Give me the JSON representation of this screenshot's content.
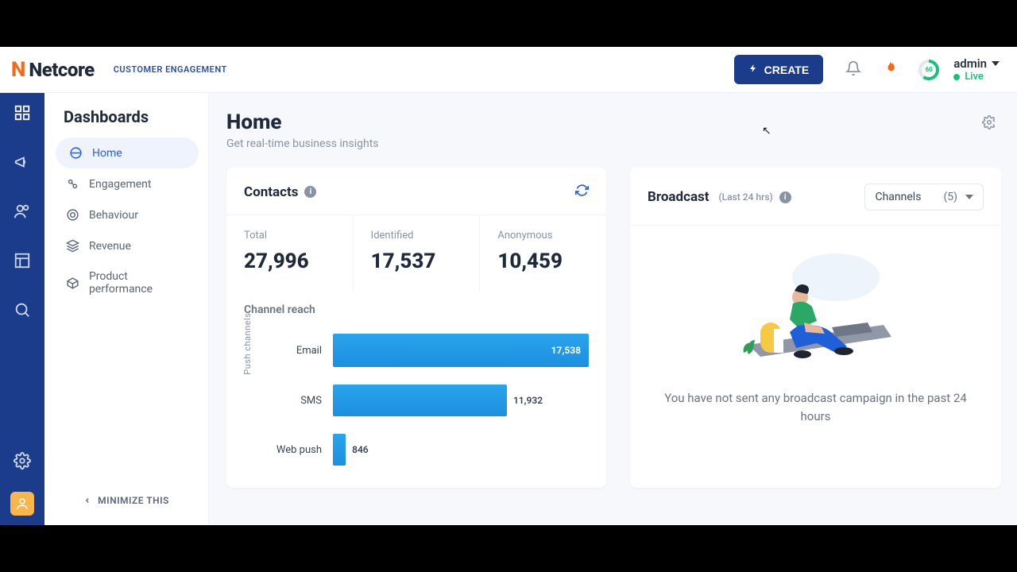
{
  "brand": {
    "mark": "N",
    "name": "Netcore",
    "sub": "CUSTOMER ENGAGEMENT"
  },
  "header": {
    "create_label": "CREATE",
    "score": "60",
    "user": "admin",
    "status": "Live"
  },
  "sidebar": {
    "title": "Dashboards",
    "items": [
      {
        "label": "Home",
        "active": true
      },
      {
        "label": "Engagement",
        "active": false
      },
      {
        "label": "Behaviour",
        "active": false
      },
      {
        "label": "Revenue",
        "active": false
      },
      {
        "label": "Product performance",
        "active": false
      }
    ],
    "minimize": "MINIMIZE THIS"
  },
  "page": {
    "title": "Home",
    "subtitle": "Get real-time business insights"
  },
  "contacts": {
    "title": "Contacts",
    "total_label": "Total",
    "total_value": "27,996",
    "identified_label": "Identified",
    "identified_value": "17,537",
    "anonymous_label": "Anonymous",
    "anonymous_value": "10,459",
    "channel_reach_label": "Channel reach",
    "ylabel": "Push channels"
  },
  "chart_data": {
    "type": "bar",
    "orientation": "horizontal",
    "categories": [
      "Email",
      "SMS",
      "Web push"
    ],
    "values": [
      17538,
      11932,
      846
    ],
    "value_labels": [
      "17,538",
      "11,932",
      "846"
    ],
    "label_inside": [
      true,
      false,
      false
    ],
    "xlim": [
      0,
      17538
    ],
    "bar_color": "#1e98e5"
  },
  "broadcast": {
    "title": "Broadcast",
    "window": "(Last 24 hrs)",
    "dropdown_label": "Channels",
    "dropdown_count": "(5)",
    "empty": "You have not sent any broadcast campaign in the past 24 hours"
  }
}
